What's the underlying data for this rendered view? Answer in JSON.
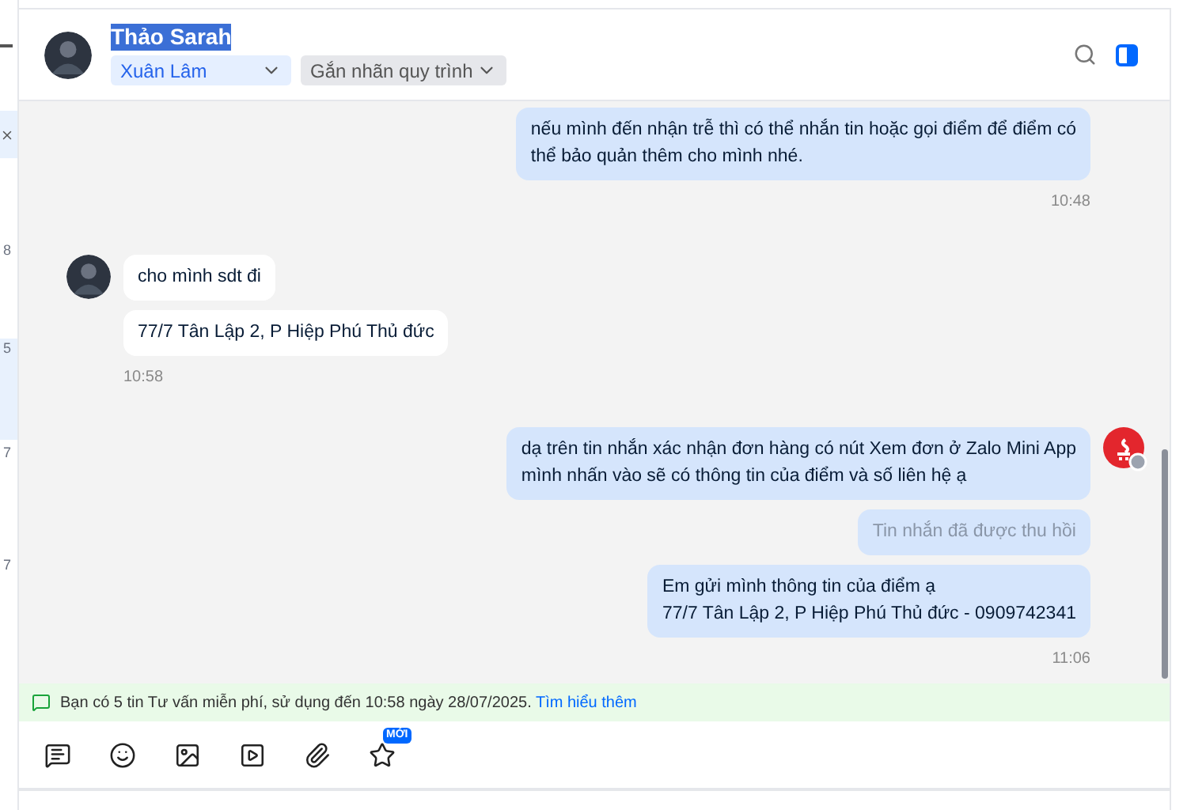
{
  "sidebar_fragments": [
    "8",
    "5",
    "7",
    "7"
  ],
  "header": {
    "name": "Thảo Sarah",
    "name_highlighted": true,
    "assignee": "Xuân Lâm",
    "label_select": "Gắn nhãn quy trình"
  },
  "groups": [
    {
      "kind": "sent",
      "avatar": false,
      "messages": [
        {
          "kind": "text",
          "text": "nếu mình đến nhận trễ thì có thể nhắn tin hoặc gọi điểm để điểm có\nthể bảo quản thêm cho mình nhé."
        }
      ],
      "time": "10:48"
    },
    {
      "kind": "received",
      "avatar": true,
      "messages": [
        {
          "kind": "text",
          "text": "cho mình sdt đi"
        },
        {
          "kind": "text",
          "text": "77/7 Tân Lập 2, P Hiệp Phú Thủ đức"
        }
      ],
      "time": "10:58"
    },
    {
      "kind": "sent",
      "avatar": true,
      "messages": [
        {
          "kind": "text",
          "text": "dạ trên tin nhắn xác nhận đơn hàng có nút Xem đơn ở Zalo Mini App\nmình nhấn vào sẽ có thông tin của điểm và số liên hệ ạ"
        },
        {
          "kind": "recalled",
          "text": "Tin nhắn đã được thu hồi"
        },
        {
          "kind": "text",
          "text": "Em gửi mình thông tin của điểm ạ\n77/7 Tân Lập 2, P Hiệp Phú Thủ đức - 0909742341"
        }
      ],
      "time": "11:06"
    }
  ],
  "banner": {
    "text": "Bạn có 5 tin Tư vấn miễn phí, sử dụng đến 10:58 ngày 28/07/2025.",
    "link": "Tìm hiểu thêm"
  },
  "toolbar": [
    {
      "kind": "message"
    },
    {
      "kind": "sticker"
    },
    {
      "kind": "image"
    },
    {
      "kind": "video"
    },
    {
      "kind": "attach"
    },
    {
      "kind": "template",
      "badge": "MỚI"
    }
  ]
}
